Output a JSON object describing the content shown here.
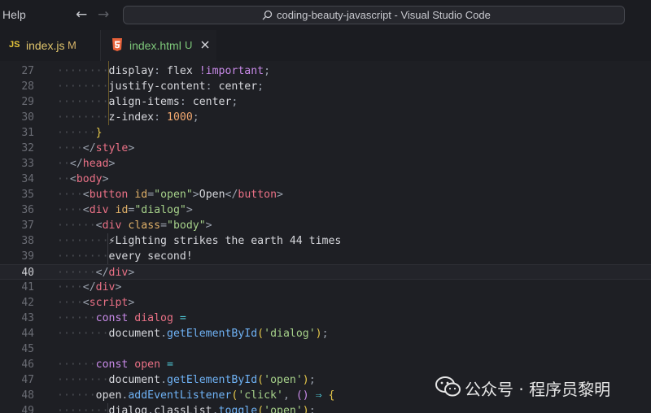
{
  "menu": {
    "help": "Help"
  },
  "command_center": {
    "text": "coding-beauty-javascript - Visual Studio Code"
  },
  "tabs": [
    {
      "icon": "JS",
      "label": "index.js",
      "status": "M"
    },
    {
      "icon": "html5-icon",
      "label": "index.html",
      "status": "U"
    }
  ],
  "editor": {
    "active_line": 40,
    "lines": [
      {
        "n": 27,
        "indent": 4,
        "tokens": [
          [
            "prop",
            "display"
          ],
          [
            "punct",
            ": "
          ],
          [
            "val",
            "flex "
          ],
          [
            "kw",
            "!important"
          ],
          [
            "punct",
            ";"
          ]
        ]
      },
      {
        "n": 28,
        "indent": 4,
        "tokens": [
          [
            "prop",
            "justify-content"
          ],
          [
            "punct",
            ": "
          ],
          [
            "val",
            "center"
          ],
          [
            "punct",
            ";"
          ]
        ]
      },
      {
        "n": 29,
        "indent": 4,
        "tokens": [
          [
            "prop",
            "align-items"
          ],
          [
            "punct",
            ": "
          ],
          [
            "val",
            "center"
          ],
          [
            "punct",
            ";"
          ]
        ]
      },
      {
        "n": 30,
        "indent": 4,
        "tokens": [
          [
            "prop",
            "z-index"
          ],
          [
            "punct",
            ": "
          ],
          [
            "num",
            "1000"
          ],
          [
            "punct",
            ";"
          ]
        ]
      },
      {
        "n": 31,
        "indent": 3,
        "tokens": [
          [
            "brace",
            "}"
          ]
        ]
      },
      {
        "n": 32,
        "indent": 2,
        "tokens": [
          [
            "punct",
            "</"
          ],
          [
            "tag",
            "style"
          ],
          [
            "punct",
            ">"
          ]
        ]
      },
      {
        "n": 33,
        "indent": 1,
        "tokens": [
          [
            "punct",
            "</"
          ],
          [
            "tag",
            "head"
          ],
          [
            "punct",
            ">"
          ]
        ]
      },
      {
        "n": 34,
        "indent": 1,
        "tokens": [
          [
            "punct",
            "<"
          ],
          [
            "tag",
            "body"
          ],
          [
            "punct",
            ">"
          ]
        ]
      },
      {
        "n": 35,
        "indent": 2,
        "tokens": [
          [
            "punct",
            "<"
          ],
          [
            "tag",
            "button"
          ],
          [
            "punct",
            " "
          ],
          [
            "attr",
            "id"
          ],
          [
            "punct",
            "="
          ],
          [
            "str",
            "\"open\""
          ],
          [
            "punct",
            ">"
          ],
          [
            "text",
            "Open"
          ],
          [
            "punct",
            "</"
          ],
          [
            "tag",
            "button"
          ],
          [
            "punct",
            ">"
          ]
        ]
      },
      {
        "n": 36,
        "indent": 2,
        "tokens": [
          [
            "punct",
            "<"
          ],
          [
            "tag",
            "div"
          ],
          [
            "punct",
            " "
          ],
          [
            "attr",
            "id"
          ],
          [
            "punct",
            "="
          ],
          [
            "str",
            "\"dialog\""
          ],
          [
            "punct",
            ">"
          ]
        ]
      },
      {
        "n": 37,
        "indent": 3,
        "tokens": [
          [
            "punct",
            "<"
          ],
          [
            "tag",
            "div"
          ],
          [
            "punct",
            " "
          ],
          [
            "attr",
            "class"
          ],
          [
            "punct",
            "="
          ],
          [
            "str",
            "\"body\""
          ],
          [
            "punct",
            ">"
          ]
        ]
      },
      {
        "n": 38,
        "indent": 4,
        "tokens": [
          [
            "bolt",
            "⚡"
          ],
          [
            "text",
            "Lighting strikes the earth 44 times"
          ]
        ]
      },
      {
        "n": 39,
        "indent": 4,
        "tokens": [
          [
            "text",
            "every second!"
          ]
        ]
      },
      {
        "n": 40,
        "indent": 3,
        "tokens": [
          [
            "punct",
            "</"
          ],
          [
            "tag",
            "div"
          ],
          [
            "punct",
            ">"
          ]
        ]
      },
      {
        "n": 41,
        "indent": 2,
        "tokens": [
          [
            "punct",
            "</"
          ],
          [
            "tag",
            "div"
          ],
          [
            "punct",
            ">"
          ]
        ]
      },
      {
        "n": 42,
        "indent": 2,
        "tokens": [
          [
            "punct",
            "<"
          ],
          [
            "tag",
            "script"
          ],
          [
            "punct",
            ">"
          ]
        ]
      },
      {
        "n": 43,
        "indent": 3,
        "tokens": [
          [
            "kw",
            "const "
          ],
          [
            "tag",
            "dialog"
          ],
          [
            "op",
            " ="
          ]
        ]
      },
      {
        "n": 44,
        "indent": 4,
        "tokens": [
          [
            "text",
            "document"
          ],
          [
            "punct",
            "."
          ],
          [
            "fn",
            "getElementById"
          ],
          [
            "brace",
            "("
          ],
          [
            "str",
            "'dialog'"
          ],
          [
            "brace",
            ")"
          ],
          [
            "punct",
            ";"
          ]
        ]
      },
      {
        "n": 45,
        "indent": 0,
        "tokens": []
      },
      {
        "n": 46,
        "indent": 3,
        "tokens": [
          [
            "kw",
            "const "
          ],
          [
            "tag",
            "open"
          ],
          [
            "op",
            " ="
          ]
        ]
      },
      {
        "n": 47,
        "indent": 4,
        "tokens": [
          [
            "text",
            "document"
          ],
          [
            "punct",
            "."
          ],
          [
            "fn",
            "getElementById"
          ],
          [
            "brace",
            "("
          ],
          [
            "str",
            "'open'"
          ],
          [
            "brace",
            ")"
          ],
          [
            "punct",
            ";"
          ]
        ]
      },
      {
        "n": 48,
        "indent": 3,
        "tokens": [
          [
            "text",
            "open"
          ],
          [
            "punct",
            "."
          ],
          [
            "fn",
            "addEventListener"
          ],
          [
            "brace",
            "("
          ],
          [
            "str",
            "'click'"
          ],
          [
            "punct",
            ", "
          ],
          [
            "kw",
            "() "
          ],
          [
            "op",
            "⇒ "
          ],
          [
            "brace",
            "{"
          ]
        ]
      },
      {
        "n": 49,
        "indent": 4,
        "tokens": [
          [
            "text",
            "dialog"
          ],
          [
            "punct",
            "."
          ],
          [
            "text",
            "classList"
          ],
          [
            "punct",
            "."
          ],
          [
            "fn",
            "toggle"
          ],
          [
            "brace",
            "("
          ],
          [
            "str",
            "'open'"
          ],
          [
            "brace",
            ")"
          ],
          [
            "punct",
            ";"
          ]
        ]
      }
    ]
  },
  "watermark": {
    "text": "公众号 · 程序员黎明"
  }
}
